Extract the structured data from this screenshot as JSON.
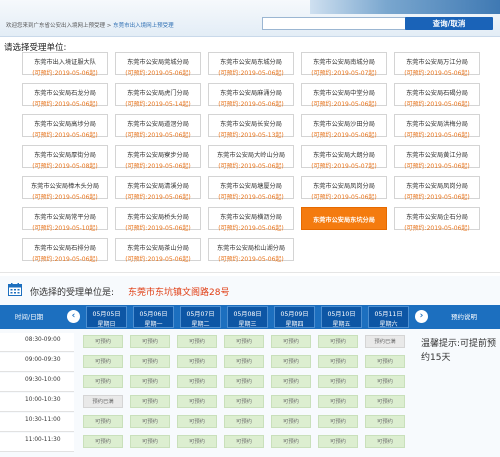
{
  "header": {
    "breadcrumb_prefix": "欢迎您来到广东省公安出入境网上预受理",
    "breadcrumb_sep": " > ",
    "breadcrumb_current": "东莞市出入境网上预受理",
    "search_placeholder": "",
    "search_button": "查询/取消"
  },
  "prompt": "请选择受理单位:",
  "units": [
    {
      "name": "东莞市出入境证服大队",
      "date": "(可预约:2019-05-06起)"
    },
    {
      "name": "东莞市公安局莞城分局",
      "date": "(可预约:2019-05-06起)"
    },
    {
      "name": "东莞市公安局东城分局",
      "date": "(可预约:2019-05-06起)"
    },
    {
      "name": "东莞市公安局南城分局",
      "date": "(可预约:2019-05-07起)"
    },
    {
      "name": "东莞市公安局万江分局",
      "date": "(可预约:2019-05-06起)"
    },
    {
      "name": "东莞市公安局石龙分局",
      "date": "(可预约:2019-05-06起)"
    },
    {
      "name": "东莞市公安局虎门分局",
      "date": "(可预约:2019-05-14起)"
    },
    {
      "name": "东莞市公安局麻涌分局",
      "date": "(可预约:2019-05-06起)"
    },
    {
      "name": "东莞市公安局中堂分局",
      "date": "(可预约:2019-05-06起)"
    },
    {
      "name": "东莞市公安局石碣分局",
      "date": "(可预约:2019-05-06起)"
    },
    {
      "name": "东莞市公安局高埗分局",
      "date": "(可预约:2019-05-06起)"
    },
    {
      "name": "东莞市公安局道滘分局",
      "date": "(可预约:2019-05-06起)"
    },
    {
      "name": "东莞市公安局长安分局",
      "date": "(可预约:2019-05-13起)"
    },
    {
      "name": "东莞市公安局沙田分局",
      "date": "(可预约:2019-05-06起)"
    },
    {
      "name": "东莞市公安局洪梅分局",
      "date": "(可预约:2019-05-06起)"
    },
    {
      "name": "东莞市公安局厚街分局",
      "date": "(可预约:2019-05-08起)"
    },
    {
      "name": "东莞市公安局寮步分局",
      "date": "(可预约:2019-05-06起)"
    },
    {
      "name": "东莞市公安局大岭山分局",
      "date": "(可预约:2019-05-06起)"
    },
    {
      "name": "东莞市公安局大朗分局",
      "date": "(可预约:2019-05-07起)"
    },
    {
      "name": "东莞市公安局黄江分局",
      "date": "(可预约:2019-05-06起)"
    },
    {
      "name": "东莞市公安局樟木头分局",
      "date": "(可预约:2019-05-06起)"
    },
    {
      "name": "东莞市公安局清溪分局",
      "date": "(可预约:2019-05-06起)"
    },
    {
      "name": "东莞市公安局塘厦分局",
      "date": "(可预约:2019-05-06起)"
    },
    {
      "name": "东莞市公安局凤岗分局",
      "date": "(可预约:2019-05-06起)"
    },
    {
      "name": "东莞市公安局凤岗分局",
      "date": "(可预约:2019-05-06起)"
    },
    {
      "name": "东莞市公安局常平分局",
      "date": "(可预约:2019-05-10起)"
    },
    {
      "name": "东莞市公安局桥头分局",
      "date": "(可预约:2019-05-06起)"
    },
    {
      "name": "东莞市公安局横沥分局",
      "date": "(可预约:2019-05-06起)"
    },
    {
      "name": "东莞市公安局东坑分局",
      "date": ""
    },
    {
      "name": "东莞市公安局企石分局",
      "date": "(可预约:2019-05-06起)"
    },
    {
      "name": "东莞市公安局石排分局",
      "date": "(可预约:2019-05-06起)"
    },
    {
      "name": "东莞市公安局茶山分局",
      "date": "(可预约:2019-05-06起)"
    },
    {
      "name": "东莞市公安局松山湖分局",
      "date": "(可预约:2019-05-06起)"
    }
  ],
  "selected_index": 28,
  "selection": {
    "label": "你选择的受理单位是:",
    "value": "东莞市东坑镇文阁路28号"
  },
  "schedule": {
    "time_col_header": "时间/日期",
    "guide_label": "预约说明",
    "days": [
      {
        "date": "05月05日",
        "weekday": "星期日"
      },
      {
        "date": "05月06日",
        "weekday": "星期一"
      },
      {
        "date": "05月07日",
        "weekday": "星期二"
      },
      {
        "date": "05月08日",
        "weekday": "星期三"
      },
      {
        "date": "05月09日",
        "weekday": "星期四"
      },
      {
        "date": "05月10日",
        "weekday": "星期五"
      },
      {
        "date": "05月11日",
        "weekday": "星期六"
      }
    ],
    "slots": [
      {
        "time": "08:30-09:00",
        "cells": [
          "可预约",
          "可预约",
          "可预约",
          "可预约",
          "可预约",
          "可预约",
          "预约已满"
        ]
      },
      {
        "time": "09:00-09:30",
        "cells": [
          "可预约",
          "可预约",
          "可预约",
          "可预约",
          "可预约",
          "可预约",
          "可预约"
        ]
      },
      {
        "time": "09:30-10:00",
        "cells": [
          "可预约",
          "可预约",
          "可预约",
          "可预约",
          "可预约",
          "可预约",
          "可预约"
        ]
      },
      {
        "time": "10:00-10:30",
        "cells": [
          "预约已满",
          "可预约",
          "可预约",
          "可预约",
          "可预约",
          "可预约",
          "可预约"
        ]
      },
      {
        "time": "10:30-11:00",
        "cells": [
          "可预约",
          "可预约",
          "可预约",
          "可预约",
          "可预约",
          "可预约",
          "可预约"
        ]
      },
      {
        "time": "11:00-11:30",
        "cells": [
          "可预约",
          "可预约",
          "可预约",
          "可预约",
          "可预约",
          "可预约",
          "可预约"
        ]
      }
    ]
  },
  "tip": "温馨提示:可提前预约15天",
  "colors": {
    "accent_blue": "#1c6fbf",
    "selected_orange": "#f47b0f",
    "date_orange": "#e8731a",
    "address_red": "#e03c12",
    "slot_green": "#dceed0"
  }
}
